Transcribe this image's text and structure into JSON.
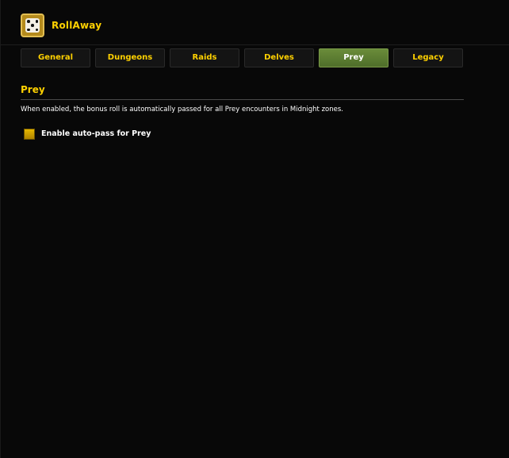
{
  "app": {
    "title": "RollAway",
    "icon": "dice-icon"
  },
  "tabs": [
    {
      "label": "General",
      "active": false
    },
    {
      "label": "Dungeons",
      "active": false
    },
    {
      "label": "Raids",
      "active": false
    },
    {
      "label": "Delves",
      "active": false
    },
    {
      "label": "Prey",
      "active": true
    },
    {
      "label": "Legacy",
      "active": false
    }
  ],
  "section": {
    "title": "Prey",
    "description": "When enabled, the bonus roll is automatically passed for all Prey encounters in Midnight zones."
  },
  "options": {
    "auto_pass_label": "Enable auto-pass for Prey",
    "auto_pass_checked": false
  },
  "colors": {
    "accent": "#ffd100",
    "active_tab": "#5f7f34",
    "background": "#080808"
  }
}
